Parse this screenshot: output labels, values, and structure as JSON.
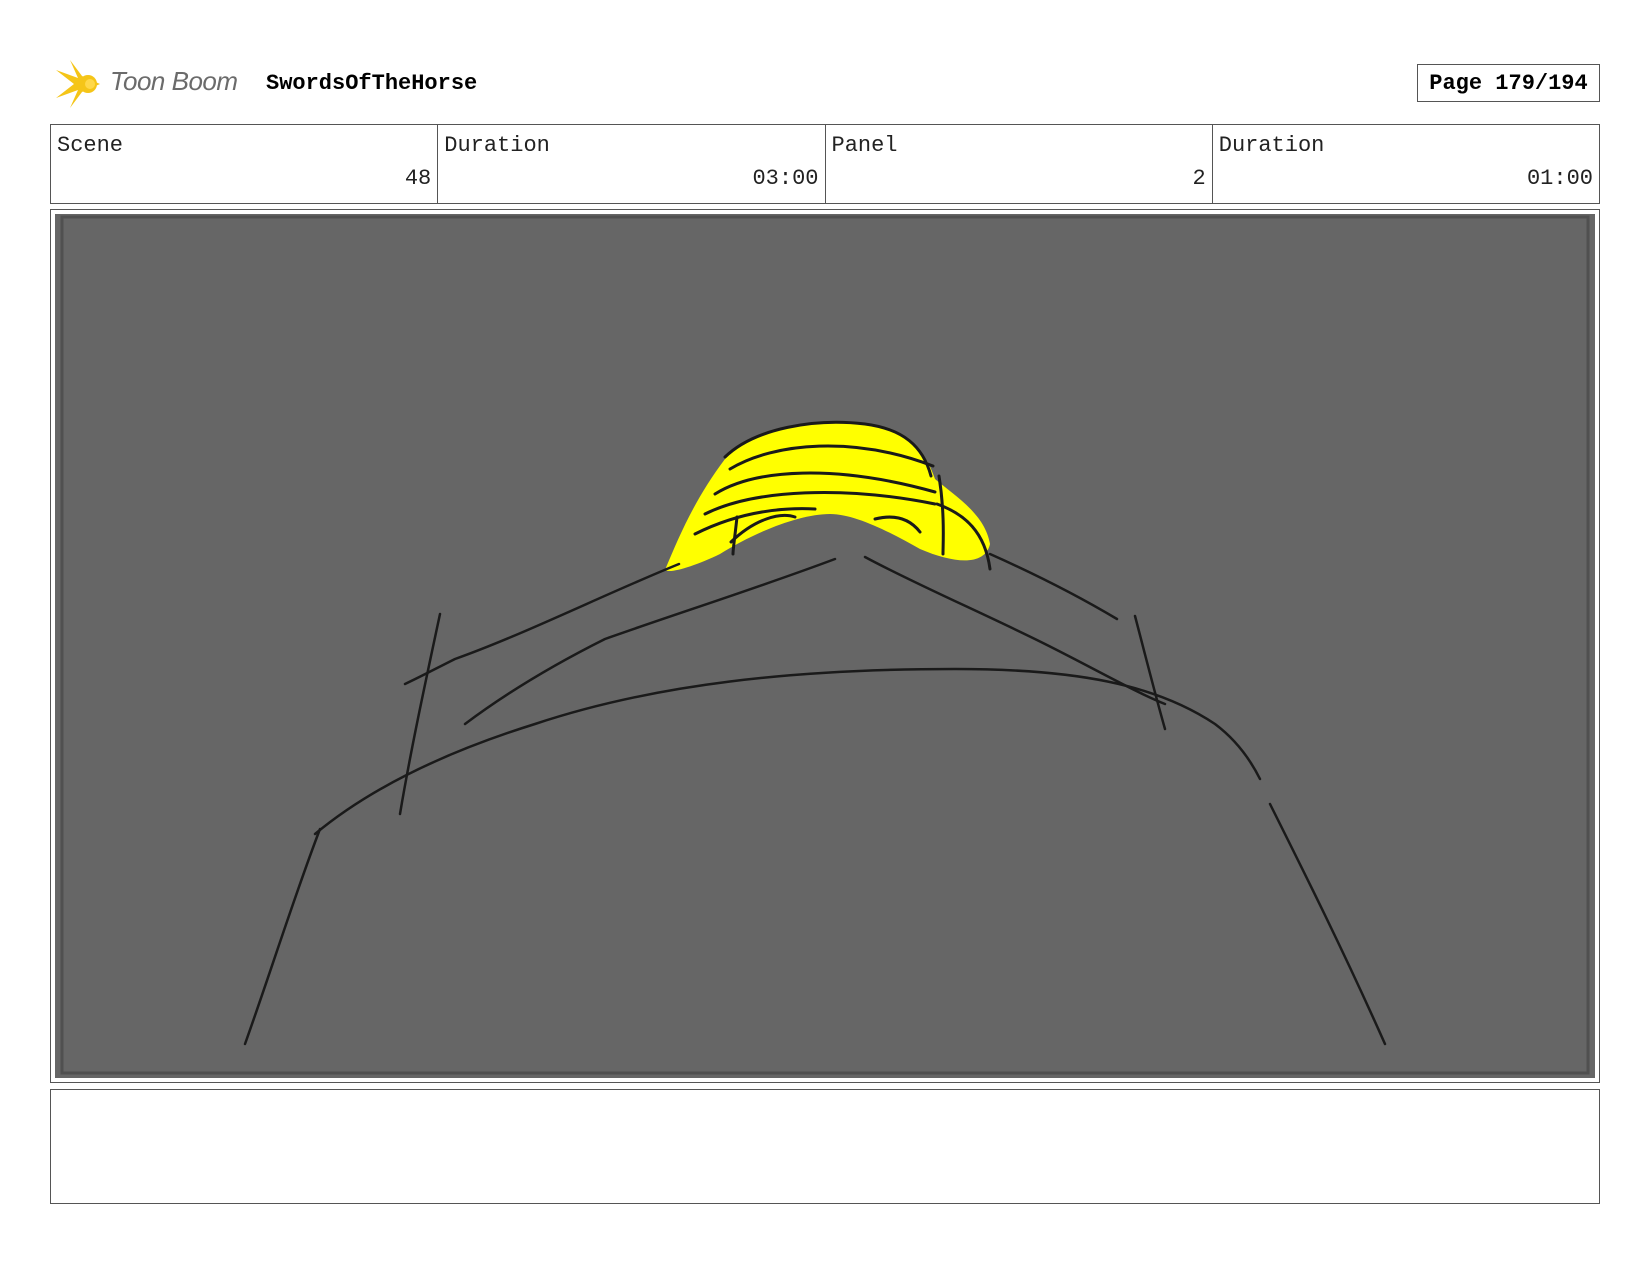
{
  "header": {
    "logo_text": "Toon Boom",
    "project_title": "SwordsOfTheHorse",
    "page_label": "Page 179/194"
  },
  "info": [
    {
      "label": "Scene",
      "value": "48"
    },
    {
      "label": "Duration",
      "value": "03:00"
    },
    {
      "label": "Panel",
      "value": "2"
    },
    {
      "label": "Duration",
      "value": "01:00"
    }
  ],
  "panel": {
    "background_color": "#666666",
    "accent_color": "#ffff00"
  },
  "notes": {
    "text": ""
  }
}
